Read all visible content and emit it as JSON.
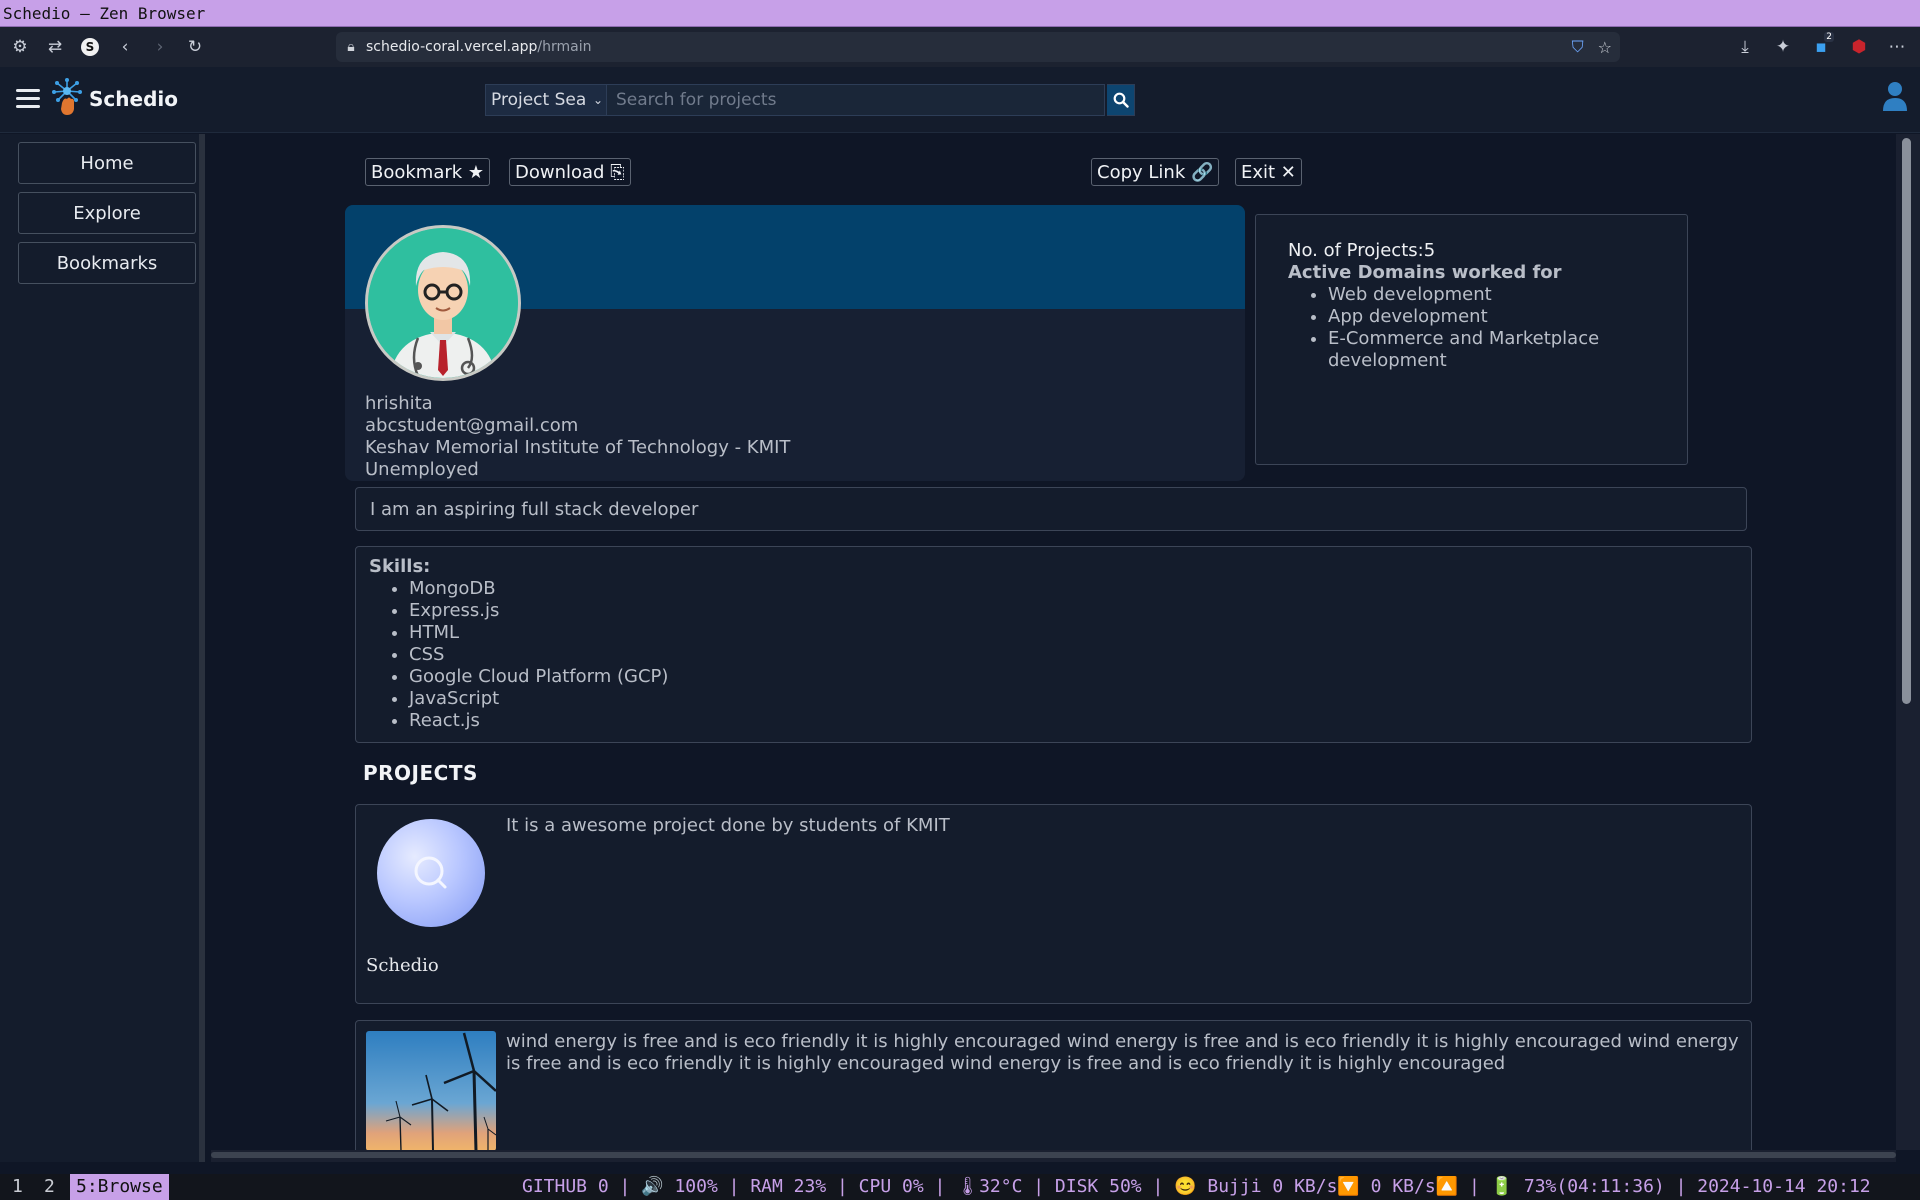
{
  "window_title": "Schedio — Zen Browser",
  "browser": {
    "url_host": "schedio-coral.vercel.app",
    "url_path": "/hrmain",
    "site_badge": "S",
    "extension_count": "2"
  },
  "header": {
    "brand": "Schedio",
    "search_scope": "Project Sea",
    "search_placeholder": "Search for projects"
  },
  "sidebar": {
    "items": [
      {
        "label": "Home"
      },
      {
        "label": "Explore"
      },
      {
        "label": "Bookmarks"
      }
    ]
  },
  "actions": {
    "bookmark": "Bookmark ★",
    "download": "Download ⎘",
    "copy_link": "Copy Link 🔗",
    "exit": "Exit ✕"
  },
  "profile": {
    "name": "hrishita",
    "email": "abcstudent@gmail.com",
    "college": "Keshav Memorial Institute of Technology - KMIT",
    "status": "Unemployed",
    "about": "I am an aspiring full stack developer"
  },
  "stats": {
    "projects_count": "No. of Projects:5",
    "domains_title": "Active Domains worked for",
    "domains": [
      "Web development",
      "App development",
      "E-Commerce and Marketplace development"
    ]
  },
  "skills": {
    "title": "Skills:",
    "items": [
      "MongoDB",
      "Express.js",
      "HTML",
      "CSS",
      "Google Cloud Platform (GCP)",
      "JavaScript",
      "React.js"
    ]
  },
  "projects": {
    "title": "PROJECTS",
    "items": [
      {
        "description": "It is a awesome project done by students of KMIT",
        "name": "Schedio"
      },
      {
        "description": "wind energy is free and is eco friendly it is highly encouraged wind energy is free and is eco friendly it is highly encouraged wind energy is free and is eco friendly it is highly encouraged wind energy is free and is eco friendly it is highly encouraged",
        "name": ""
      }
    ]
  },
  "statusbar": {
    "workspaces": [
      "1",
      "2",
      "5:Browse"
    ],
    "info": "GITHUB 0 | 🔊 100% | RAM 23% | CPU 0% | 🌡32°C | DISK 50% | 😊 Bujji 0 KB/s🔽 0 KB/s🔼 | 🔋 73%(04:11:36) | 2024-10-14 20:12"
  },
  "colors": {
    "accent": "#03416b",
    "window_titlebar": "#c7a0e8",
    "background": "#0f1626"
  }
}
